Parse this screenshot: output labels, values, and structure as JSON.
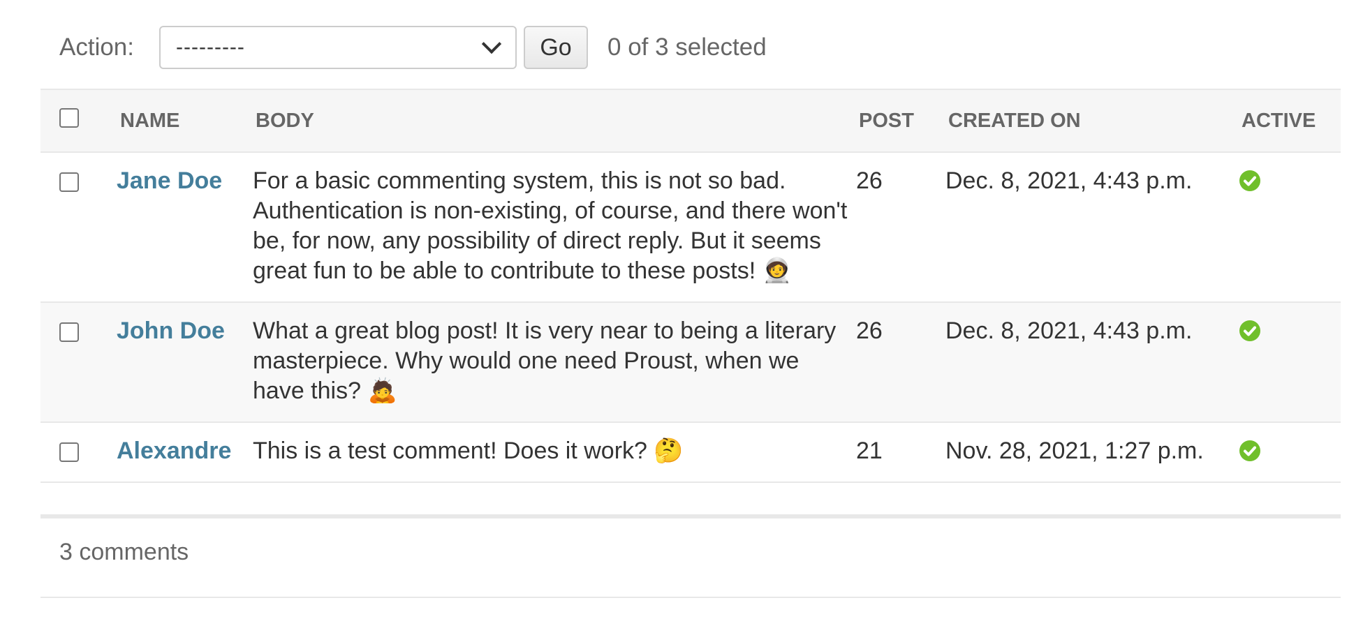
{
  "actions": {
    "label": "Action:",
    "select_value": "---------",
    "go_label": "Go",
    "selected_count": "0 of 3 selected"
  },
  "table": {
    "headers": {
      "name": "NAME",
      "body": "BODY",
      "post": "POST",
      "created_on": "CREATED ON",
      "active": "ACTIVE"
    },
    "rows": [
      {
        "name": "Jane Doe",
        "body": "For a basic commenting system, this is not so bad. Authentication is non-existing, of course, and there won't be, for now, any possibility of direct reply. But it seems great fun to be able to contribute to these posts! 🧑‍🚀",
        "post": "26",
        "created_on": "Dec. 8, 2021, 4:43 p.m.",
        "active": true
      },
      {
        "name": "John Doe",
        "body": "What a great blog post! It is very near to being a literary masterpiece. Why would one need Proust, when we have this? 🙇",
        "post": "26",
        "created_on": "Dec. 8, 2021, 4:43 p.m.",
        "active": true
      },
      {
        "name": "Alexandre",
        "body": "This is a test comment! Does it work? 🤔",
        "post": "21",
        "created_on": "Nov. 28, 2021, 1:27 p.m.",
        "active": true
      }
    ]
  },
  "paginator": {
    "text": "3 comments"
  },
  "colors": {
    "link": "#447e9b",
    "active_icon": "#70bf2b",
    "header_bg": "#f6f6f6",
    "row_alt_bg": "#f8f8f8"
  },
  "icons": {
    "active": "check-circle-icon",
    "select_arrow": "chevron-down-icon"
  }
}
